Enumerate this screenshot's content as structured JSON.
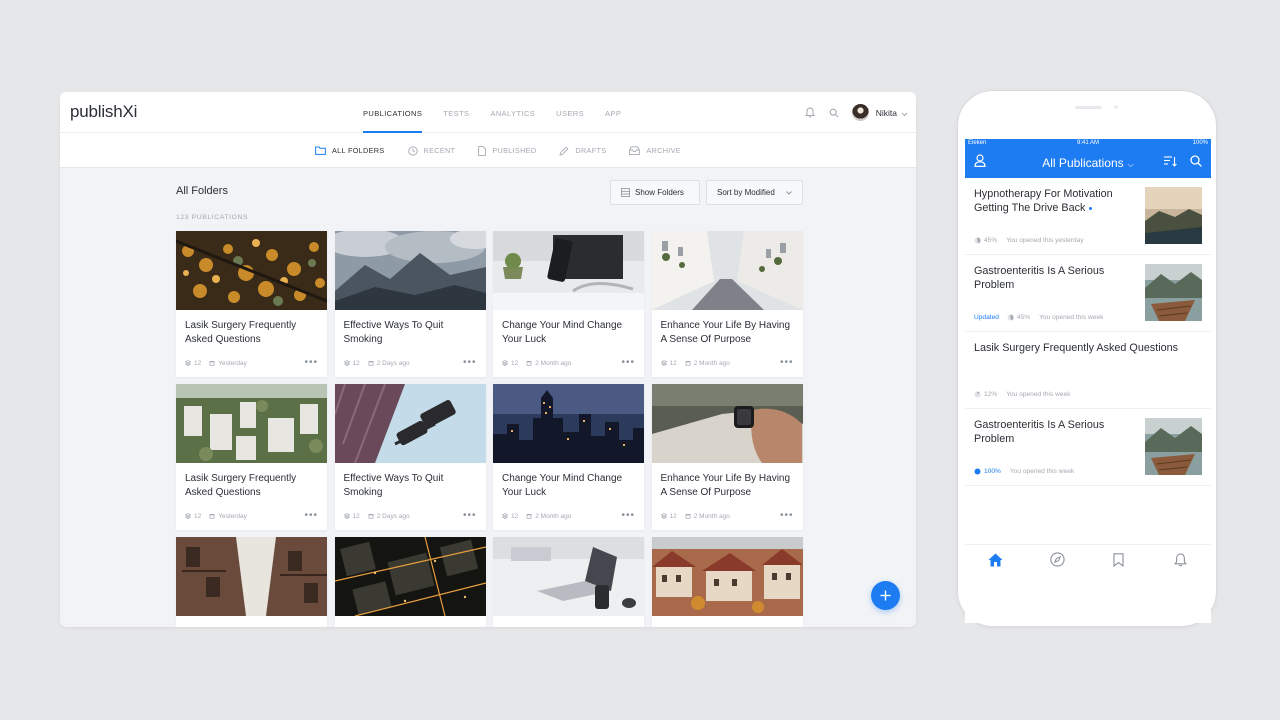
{
  "desktop": {
    "logo": "publishXi",
    "nav": [
      {
        "label": "PUBLICATIONS",
        "active": true
      },
      {
        "label": "TESTS",
        "active": false
      },
      {
        "label": "ANALYTICS",
        "active": false
      },
      {
        "label": "USERS",
        "active": false
      },
      {
        "label": "APP",
        "active": false
      }
    ],
    "user": {
      "name": "Nikita"
    },
    "subnav": {
      "all_folders": "ALL FOLDERS",
      "recent": "RECENT",
      "published": "PUBLISHED",
      "drafts": "DRAFTS",
      "archive": "ARCHIVE"
    },
    "main": {
      "title": "All Folders",
      "count": "123 PUBLICATIONS",
      "show_folders": "Show Folders",
      "sort": "Sort by Modified"
    },
    "cards": [
      {
        "title": "Lasik Surgery Frequently Asked Questions",
        "pages": "12",
        "date": "Yesterday",
        "image": "autumn-berries"
      },
      {
        "title": "Effective Ways To Quit Smoking",
        "pages": "12",
        "date": "2 Days ago",
        "image": "mountain-clouds"
      },
      {
        "title": "Change Your Mind Change Your Luck",
        "pages": "12",
        "date": "2 Month ago",
        "image": "desk-devices"
      },
      {
        "title": "Enhance Your Life By Having A Sense Of Purpose",
        "pages": "12",
        "date": "2 Month ago",
        "image": "white-street"
      },
      {
        "title": "Lasik Surgery Frequently Asked Questions",
        "pages": "12",
        "date": "Yesterday",
        "image": "city-aerial"
      },
      {
        "title": "Effective Ways To Quit Smoking",
        "pages": "12",
        "date": "2 Days ago",
        "image": "security-camera"
      },
      {
        "title": "Change Your Mind Change Your Luck",
        "pages": "12",
        "date": "2 Month ago",
        "image": "night-skyline"
      },
      {
        "title": "Enhance Your Life By Having A Sense Of Purpose",
        "pages": "12",
        "date": "2 Month ago",
        "image": "smartwatch-wrist"
      },
      {
        "title": "",
        "pages": "",
        "date": "",
        "image": "old-building"
      },
      {
        "title": "",
        "pages": "",
        "date": "",
        "image": "night-city-aerial"
      },
      {
        "title": "",
        "pages": "",
        "date": "",
        "image": "laptop-desk"
      },
      {
        "title": "",
        "pages": "",
        "date": "",
        "image": "rooftops-town"
      }
    ]
  },
  "mobile": {
    "status": {
      "carrier": "Eleken",
      "time": "9:41 AM",
      "battery": "100%"
    },
    "title": "All Publications",
    "items": [
      {
        "title": "Hypnotherapy For Motivation Getting The Drive Back",
        "updated": "",
        "progress": "45%",
        "opened": "You opened this yesterday",
        "has_thumb": true,
        "unread": true,
        "progress_value": 0.45
      },
      {
        "title": "Gastroenteritis Is A Serious Problem",
        "updated": "Updated",
        "progress": "45%",
        "opened": "You opened this week",
        "has_thumb": true,
        "unread": false,
        "progress_value": 0.45
      },
      {
        "title": "Lasik Surgery Frequently Asked Questions",
        "updated": "",
        "progress": "12%",
        "opened": "You opened this week",
        "has_thumb": false,
        "unread": false,
        "progress_value": 0.12
      },
      {
        "title": "Gastroenteritis Is A Serious Problem",
        "updated": "",
        "progress": "100%",
        "opened": "You opened this week",
        "has_thumb": true,
        "unread": false,
        "progress_value": 1.0
      }
    ]
  },
  "colors": {
    "accent": "#1e7cf2",
    "text": "#2b2f36",
    "muted": "#a4a9b2",
    "background": "#f1f3f6"
  }
}
